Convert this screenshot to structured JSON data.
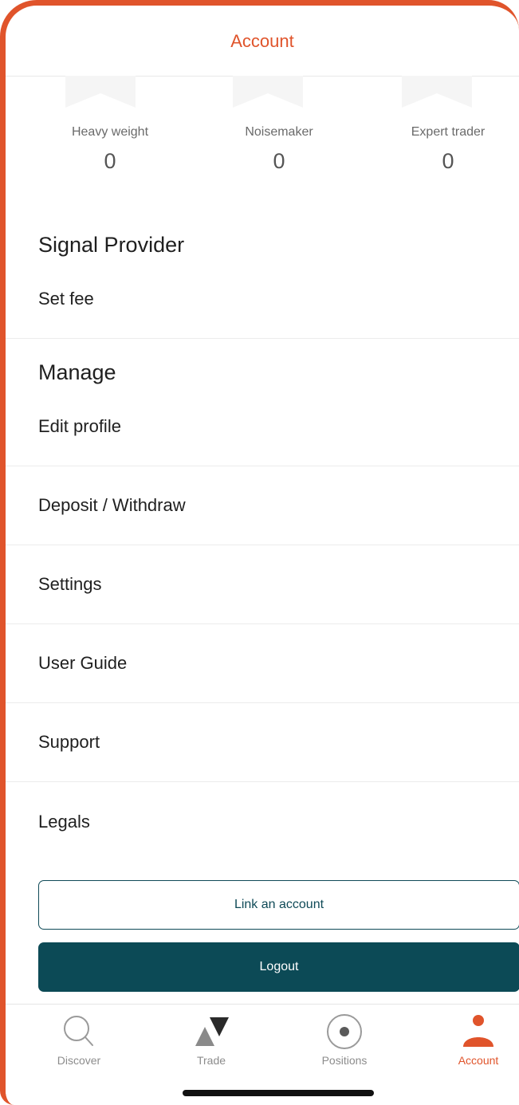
{
  "header": {
    "title": "Account"
  },
  "badges": [
    {
      "label": "Heavy weight",
      "count": "0"
    },
    {
      "label": "Noisemaker",
      "count": "0"
    },
    {
      "label": "Expert trader",
      "count": "0"
    }
  ],
  "signal_provider": {
    "title": "Signal Provider",
    "set_fee": "Set fee"
  },
  "manage": {
    "title": "Manage",
    "items": [
      "Edit profile",
      "Deposit / Withdraw",
      "Settings",
      "User Guide",
      "Support",
      "Legals"
    ]
  },
  "buttons": {
    "link_account": "Link an account",
    "logout": "Logout"
  },
  "tabbar": {
    "tabs": [
      {
        "label": "Discover",
        "icon": "search-icon"
      },
      {
        "label": "Trade",
        "icon": "trade-icon"
      },
      {
        "label": "Positions",
        "icon": "positions-icon"
      },
      {
        "label": "Account",
        "icon": "account-icon",
        "active": true
      }
    ]
  },
  "colors": {
    "accent": "#e0542b",
    "primary_button": "#0c4a56",
    "frame": "#e0542b"
  }
}
